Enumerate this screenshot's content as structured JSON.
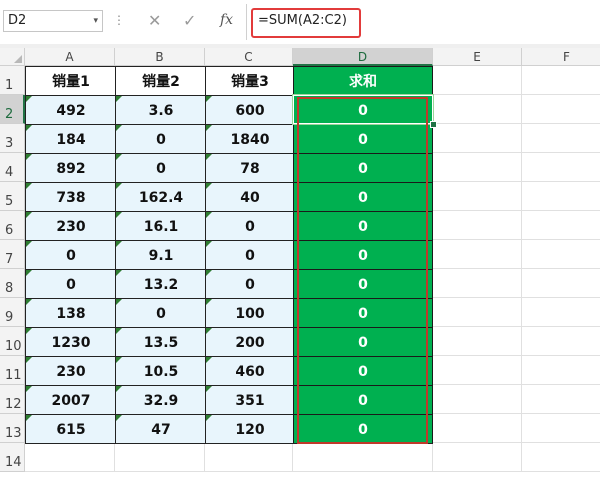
{
  "formula_bar": {
    "name_box": "D2",
    "dropdown_glyph": "▾",
    "separator": "⋮",
    "cancel_glyph": "✕",
    "enter_glyph": "✓",
    "fx_label": "fx",
    "formula": "=SUM(A2:C2)"
  },
  "columns": [
    "A",
    "B",
    "C",
    "D",
    "E",
    "F"
  ],
  "rows": [
    "1",
    "2",
    "3",
    "4",
    "5",
    "6",
    "7",
    "8",
    "9",
    "10",
    "11",
    "12",
    "13",
    "14"
  ],
  "table": {
    "headers": [
      "销量1",
      "销量2",
      "销量3",
      "求和"
    ],
    "data": [
      [
        "492",
        "3.6",
        "600",
        "0"
      ],
      [
        "184",
        "0",
        "1840",
        "0"
      ],
      [
        "892",
        "0",
        "78",
        "0"
      ],
      [
        "738",
        "162.4",
        "40",
        "0"
      ],
      [
        "230",
        "16.1",
        "0",
        "0"
      ],
      [
        "0",
        "9.1",
        "0",
        "0"
      ],
      [
        "0",
        "13.2",
        "0",
        "0"
      ],
      [
        "138",
        "0",
        "100",
        "0"
      ],
      [
        "1230",
        "13.5",
        "200",
        "0"
      ],
      [
        "230",
        "10.5",
        "460",
        "0"
      ],
      [
        "2007",
        "32.9",
        "351",
        "0"
      ],
      [
        "615",
        "47",
        "120",
        "0"
      ]
    ]
  },
  "active_cell": "D2",
  "colors": {
    "sum_fill": "#00B050",
    "data_fill": "#E8F5FC",
    "highlight": "#E23B3B",
    "selection": "#217346"
  }
}
